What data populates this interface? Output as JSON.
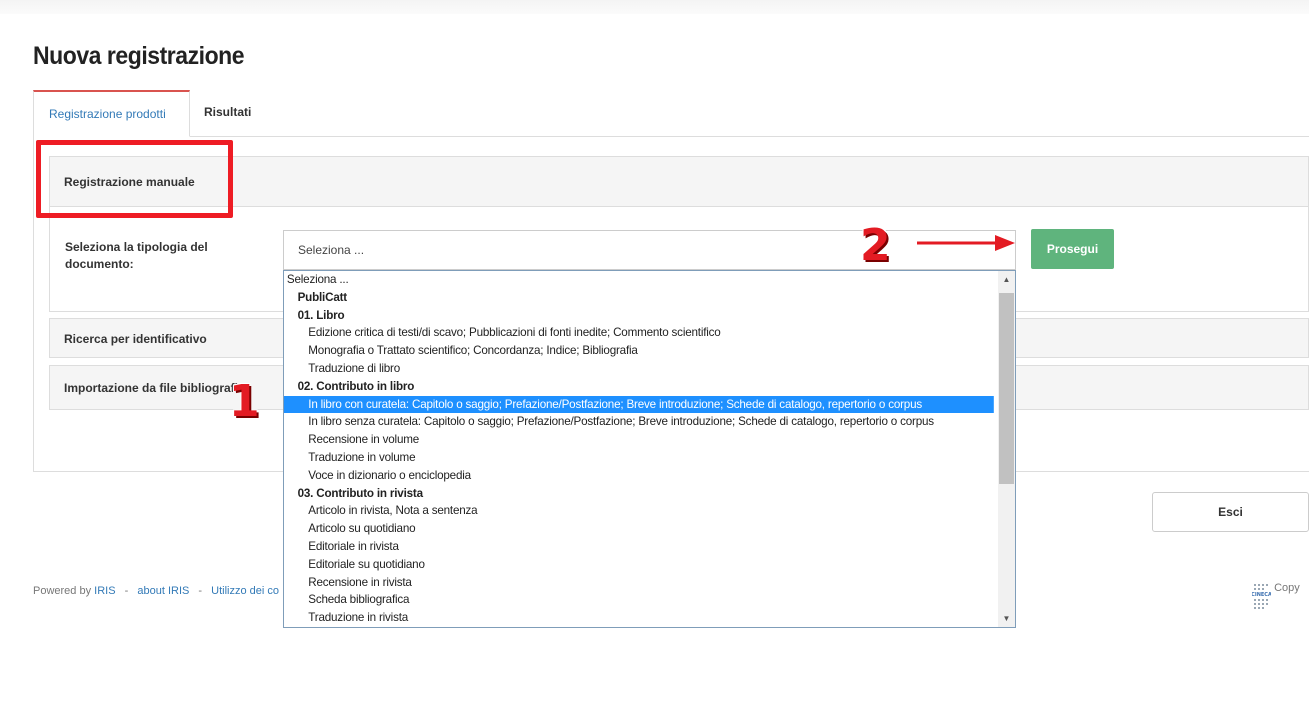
{
  "page": {
    "title": "Nuova registrazione"
  },
  "tabs": [
    {
      "label": "Registrazione prodotti",
      "active": true
    },
    {
      "label": "Risultati",
      "active": false
    }
  ],
  "manual_panel": {
    "heading": "Registrazione manuale",
    "field_label": "Seleziona la tipologia del documento:",
    "select_value": "Seleziona ...",
    "continue_button": "Prosegui"
  },
  "panels": {
    "ricerca": "Ricerca per identificativo",
    "importazione": "Importazione da file bibliografi"
  },
  "dropdown": {
    "options": [
      {
        "label": "Seleziona ...",
        "kind": "top"
      },
      {
        "label": "PubliCatt",
        "kind": "group"
      },
      {
        "label": "01. Libro",
        "kind": "group"
      },
      {
        "label": "Edizione critica di testi/di scavo; Pubblicazioni di fonti inedite; Commento scientifico",
        "kind": "option"
      },
      {
        "label": "Monografia o Trattato scientifico; Concordanza; Indice; Bibliografia",
        "kind": "option"
      },
      {
        "label": "Traduzione di libro",
        "kind": "option"
      },
      {
        "label": "02. Contributo in libro",
        "kind": "group"
      },
      {
        "label": "In libro con curatela: Capitolo o saggio; Prefazione/Postfazione; Breve introduzione; Schede di catalogo, repertorio o corpus",
        "kind": "option",
        "selected": true
      },
      {
        "label": "In libro senza curatela: Capitolo o saggio; Prefazione/Postfazione; Breve introduzione; Schede di catalogo, repertorio o corpus",
        "kind": "option"
      },
      {
        "label": "Recensione in volume",
        "kind": "option"
      },
      {
        "label": "Traduzione in volume",
        "kind": "option"
      },
      {
        "label": "Voce in dizionario o enciclopedia",
        "kind": "option"
      },
      {
        "label": "03. Contributo in rivista",
        "kind": "group"
      },
      {
        "label": "Articolo in rivista, Nota a sentenza",
        "kind": "option"
      },
      {
        "label": "Articolo su quotidiano",
        "kind": "option"
      },
      {
        "label": "Editoriale in rivista",
        "kind": "option"
      },
      {
        "label": "Editoriale su quotidiano",
        "kind": "option"
      },
      {
        "label": "Recensione in rivista",
        "kind": "option"
      },
      {
        "label": "Scheda bibliografica",
        "kind": "option"
      },
      {
        "label": "Traduzione in rivista",
        "kind": "option"
      }
    ]
  },
  "buttons": {
    "exit": "Esci"
  },
  "footer": {
    "powered_prefix": "Powered by ",
    "iris_link": "IRIS",
    "about_link": "about IRIS",
    "cookie_link": "Utilizzo dei co",
    "separator": "-",
    "copyright": "Copy",
    "cineca_logo_text": "CINECA"
  },
  "annotations": {
    "marker_1": "1",
    "marker_2": "2",
    "highlight_color": "#ee1c24",
    "arrow_color": "#e31b23"
  },
  "colors": {
    "accent_link": "#337ab7",
    "success_button": "#5fb47d",
    "selected_option": "#1e90ff"
  }
}
